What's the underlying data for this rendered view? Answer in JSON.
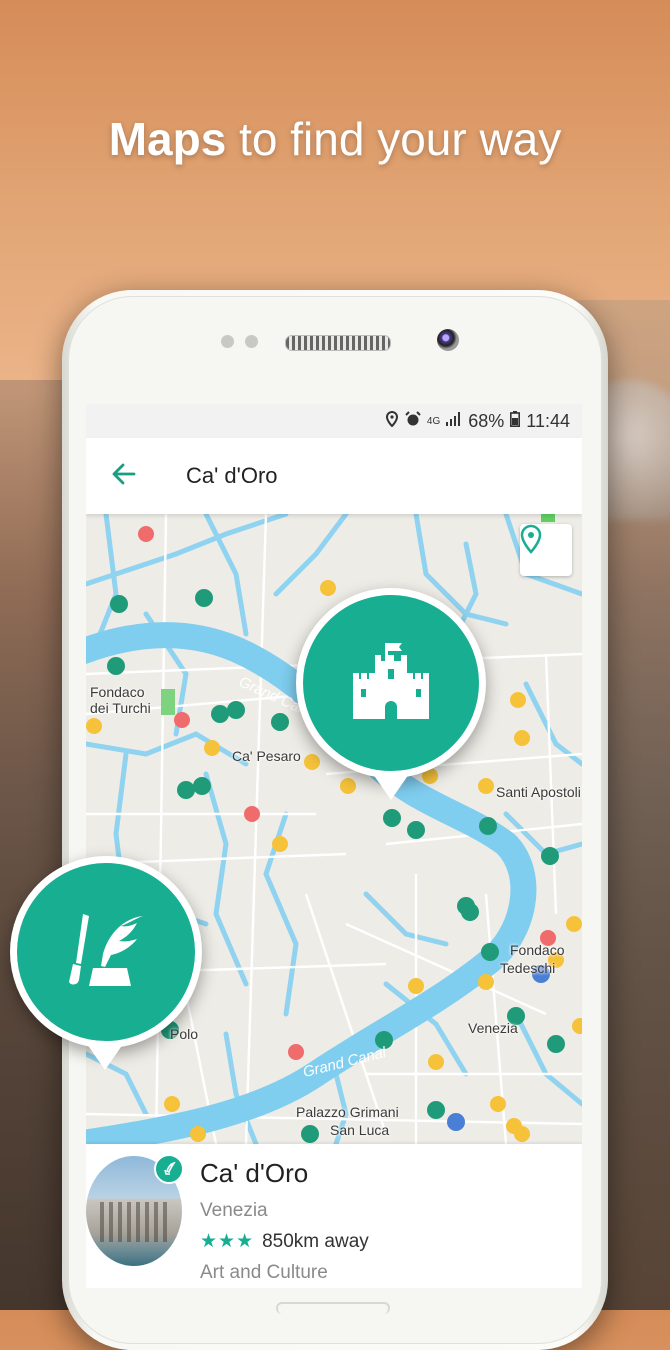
{
  "headline": {
    "bold": "Maps",
    "rest": " to find your way"
  },
  "status_bar": {
    "battery": "68%",
    "time": "11:44",
    "network": "4G"
  },
  "app_bar": {
    "title": "Ca' d'Oro"
  },
  "map": {
    "labels": [
      "Fondaco",
      "dei Turchi",
      "Ca' Pesaro",
      "Santi Apostoli",
      "Fondaco",
      "Tedeschi",
      "Venezia",
      "Polo",
      "Palazzo Grimani",
      "San Luca"
    ],
    "canal_label": "Grand Canal"
  },
  "card": {
    "title": "Ca' d'Oro",
    "city": "Venezia",
    "stars": "★★★",
    "distance": "850km away",
    "category": "Art and Culture"
  },
  "colors": {
    "accent": "#17ae92",
    "canal": "#7fcdef",
    "map_bg": "#eeece6"
  }
}
